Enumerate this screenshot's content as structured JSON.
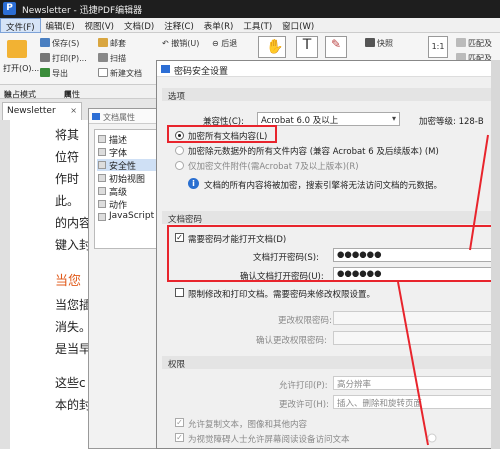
{
  "app": {
    "title": "Newsletter - 迅捷PDF编辑器"
  },
  "menu": [
    {
      "label": "文件(F)",
      "active": true
    },
    {
      "label": "编辑(E)"
    },
    {
      "label": "视图(V)"
    },
    {
      "label": "文档(D)"
    },
    {
      "label": "注释(C)"
    },
    {
      "label": "表单(R)"
    },
    {
      "label": "工具(T)"
    },
    {
      "label": "窗口(W)"
    }
  ],
  "toolbar": {
    "open": "打开(O)...",
    "save_as": "保存(S)",
    "print": "打印(P)...",
    "export": "导出",
    "mail": "邮套",
    "scan": "扫描",
    "new_doc": "新建文档",
    "undo": "撤销(U)",
    "back": "后退",
    "snapshot": "快照",
    "page_fit_right": "匹配及",
    "page_fit_right2": "匹配及"
  },
  "modebar": {
    "mode": "独占模式",
    "props": "属性"
  },
  "doc_tab": {
    "label": "Newsletter",
    "close": "×"
  },
  "doc_lines": [
    "将其",
    "位符",
    "作时",
    "此。",
    "的内容",
    "键入封",
    "当您",
    "当您插",
    "消失。",
    "是当早",
    "这些c",
    "本的封"
  ],
  "prop_window": {
    "title": "文档属性",
    "items": [
      "描述",
      "字体",
      "安全性",
      "初始视图",
      "高级",
      "动作",
      "JavaScript"
    ]
  },
  "dialog": {
    "title": "密码安全设置",
    "options_section": "选项",
    "compat_label": "兼容性(C):",
    "compat_value": "Acrobat 6.0 及以上",
    "encrypt_level": "加密等级: 128-B",
    "radio_all": "加密所有文档内容(L)",
    "radio_except_meta": "加密除元数据外的所有文件内容 (兼容 Acrobat 6 及后续版本) (M)",
    "radio_attach": "仅加密文件附件(需Acrobat 7及以上版本)(R)",
    "info_text": "文档的所有内容将被加密，搜索引擎将无法访问文档的元数据。",
    "docpw_section": "文档密码",
    "require_pw": "需要密码才能打开文档(D)",
    "open_pw_label": "文档打开密码(S):",
    "open_pw_value": "●●●●●●",
    "confirm_pw_label": "确认文档打开密码(U):",
    "confirm_pw_value": "●●●●●●",
    "restrict": "限制修改和打印文档。需要密码来修改权限设置。",
    "perm_pw_label": "更改权限密码:",
    "confirm_perm_pw_label": "确认更改权限密码:",
    "perm_section": "权限",
    "allow_print_label": "允许打印(P):",
    "allow_print_value": "高分辨率",
    "allow_change_label": "更改许可(H):",
    "allow_change_value": "插入、删除和旋转页面",
    "allow_copy": "允许复制文本，图像和其他内容",
    "allow_reader": "为视觉障碍人士允许屏幕阅读设备访问文本"
  }
}
